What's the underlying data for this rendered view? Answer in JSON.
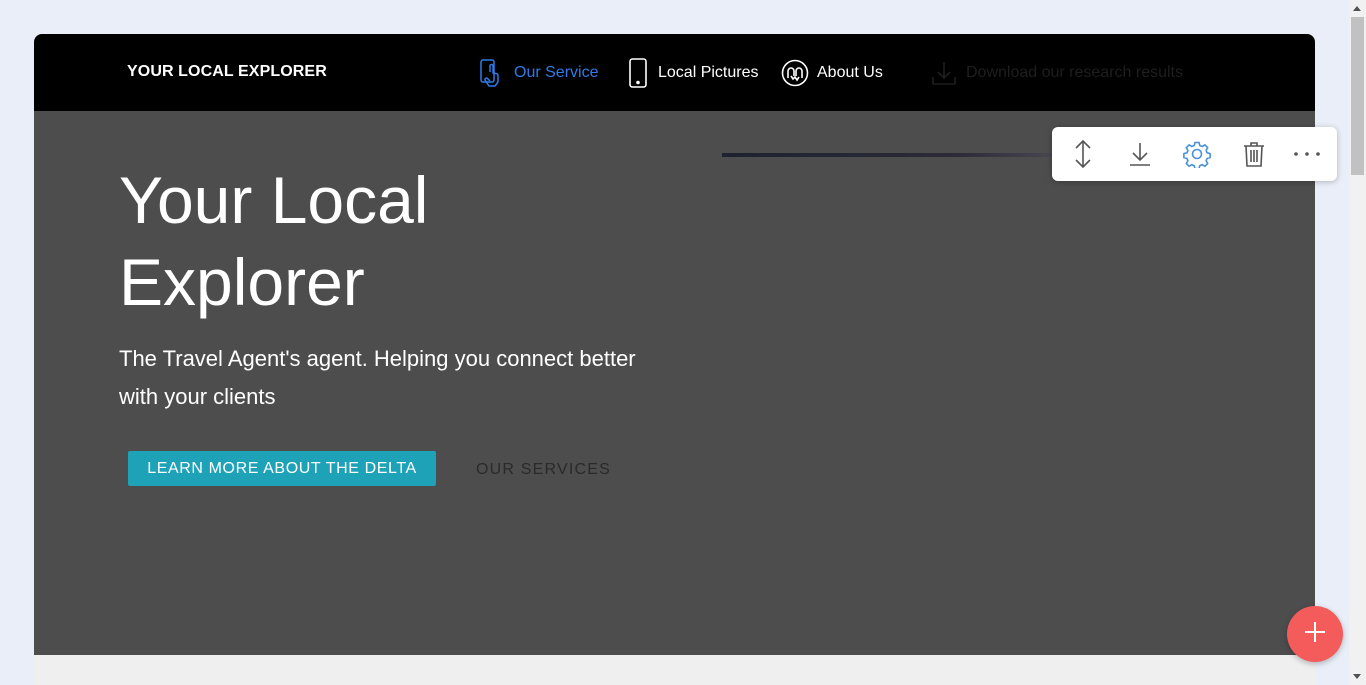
{
  "navbar": {
    "brand": "YOUR LOCAL EXPLORER",
    "items": [
      {
        "label": "Our Service",
        "icon": "touch-phone-icon",
        "active": true,
        "color": "#2e7be8"
      },
      {
        "label": "Local Pictures",
        "icon": "smartphone-icon"
      },
      {
        "label": "About Us",
        "icon": "handshake-icon"
      },
      {
        "label": "Download our research results",
        "icon": "download-icon",
        "color": "#1e1e1e"
      }
    ]
  },
  "hero": {
    "title": "Your Local Explorer",
    "subtitle": "The Travel Agent's agent. Helping you connect better with your clients",
    "primary_button": "LEARN MORE ABOUT THE DELTA",
    "secondary_button": "OUR SERVICES",
    "background": "#4d4d4d",
    "button_color": "#1ea2b8"
  },
  "toolbar": {
    "tools": [
      "resize-vertical-icon",
      "download-icon",
      "settings-icon",
      "trash-icon",
      "more-icon"
    ],
    "active_color": "#4a90d9"
  },
  "fab": {
    "icon": "plus-icon",
    "color": "#f45c5c"
  }
}
